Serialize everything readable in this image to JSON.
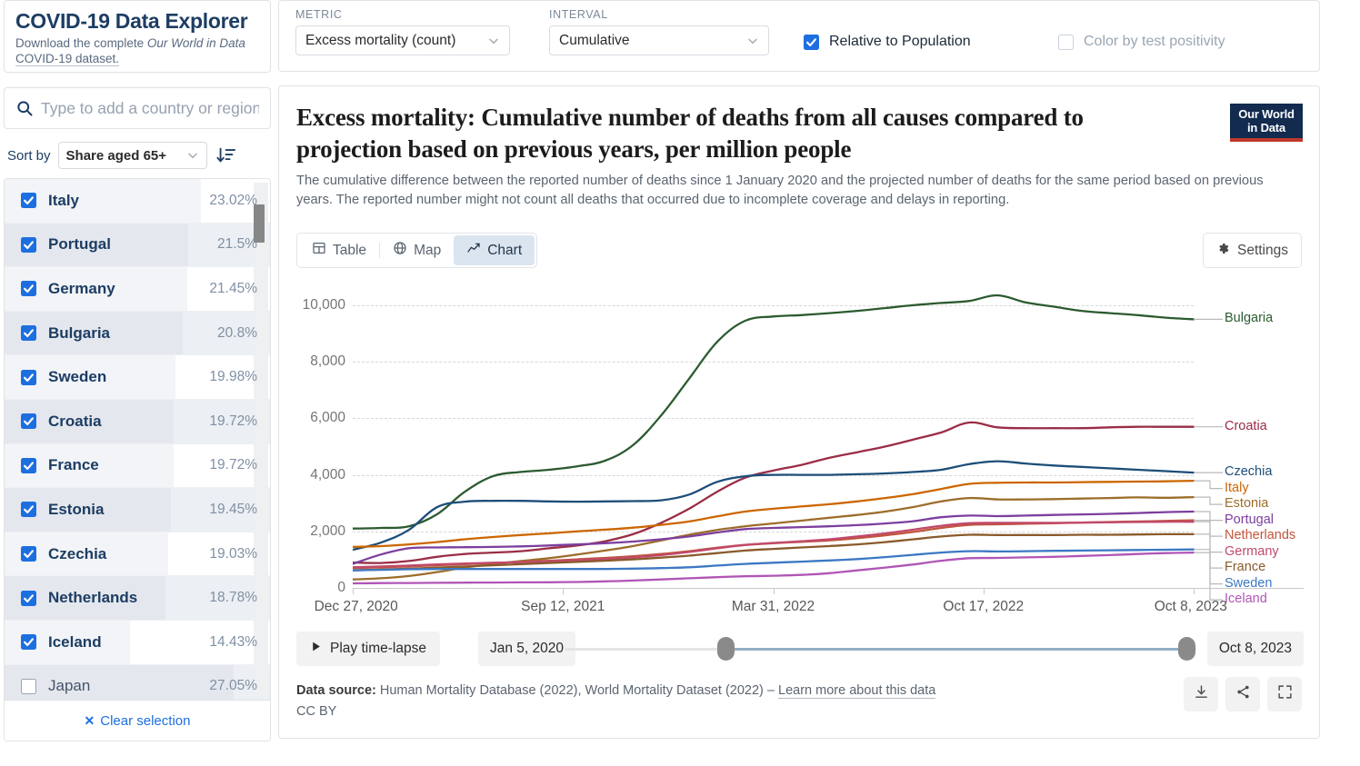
{
  "brand": {
    "title": "COVID-19 Data Explorer",
    "subtitle_pre": "Download the complete ",
    "subtitle_em": "Our World in Data",
    "subtitle_link": "COVID-19 dataset."
  },
  "search": {
    "placeholder": "Type to add a country or region...",
    "value": ""
  },
  "sort": {
    "label": "Sort by",
    "selected": "Share aged 65+",
    "direction_icon": "sort-descending-icon"
  },
  "country_list": {
    "max_value": 27.05,
    "rows": [
      {
        "name": "Italy",
        "value": "23.02%",
        "num": 23.02,
        "checked": true
      },
      {
        "name": "Portugal",
        "value": "21.5%",
        "num": 21.5,
        "checked": true
      },
      {
        "name": "Germany",
        "value": "21.45%",
        "num": 21.45,
        "checked": true
      },
      {
        "name": "Bulgaria",
        "value": "20.8%",
        "num": 20.8,
        "checked": true
      },
      {
        "name": "Sweden",
        "value": "19.98%",
        "num": 19.98,
        "checked": true
      },
      {
        "name": "Croatia",
        "value": "19.72%",
        "num": 19.72,
        "checked": true
      },
      {
        "name": "France",
        "value": "19.72%",
        "num": 19.72,
        "checked": true
      },
      {
        "name": "Estonia",
        "value": "19.45%",
        "num": 19.45,
        "checked": true
      },
      {
        "name": "Czechia",
        "value": "19.03%",
        "num": 19.03,
        "checked": true
      },
      {
        "name": "Netherlands",
        "value": "18.78%",
        "num": 18.78,
        "checked": true
      },
      {
        "name": "Iceland",
        "value": "14.43%",
        "num": 14.43,
        "checked": true
      },
      {
        "name": "Japan",
        "value": "27.05%",
        "num": 27.05,
        "checked": false
      }
    ],
    "clear_label": "Clear selection"
  },
  "controls": {
    "metric_label": "METRIC",
    "metric_value": "Excess mortality (count)",
    "interval_label": "INTERVAL",
    "interval_value": "Cumulative",
    "relative_label": "Relative to Population",
    "relative_checked": true,
    "positivity_label": "Color by test positivity",
    "positivity_checked": false
  },
  "chart": {
    "title": "Excess mortality: Cumulative number of deaths from all causes compared to projection based on previous years, per million people",
    "subtitle": "The cumulative difference between the reported number of deaths since 1 January 2020 and the projected number of deaths for the same period based on previous years. The reported number might not count all deaths that occurred due to incomplete coverage and delays in reporting.",
    "logo_line1": "Our World",
    "logo_line2": "in Data",
    "tabs": [
      {
        "label": "Table",
        "icon": "table-icon",
        "active": false
      },
      {
        "label": "Map",
        "icon": "globe-icon",
        "active": false
      },
      {
        "label": "Chart",
        "icon": "line-chart-icon",
        "active": true
      }
    ],
    "settings_label": "Settings"
  },
  "timeline": {
    "play_label": "Play time-lapse",
    "start_date": "Jan 5, 2020",
    "end_date": "Oct 8, 2023",
    "handle_left_pct": 25.5,
    "handle_right_pct": 98.5
  },
  "footer": {
    "source_prefix": "Data source:",
    "source_text": "Human Mortality Database (2022), World Mortality Dataset (2022) – ",
    "source_link": "Learn more about this data",
    "license": "CC BY",
    "buttons": [
      "download-icon",
      "share-icon",
      "expand-icon"
    ]
  },
  "chart_data": {
    "type": "line",
    "title": "Excess mortality: Cumulative number of deaths from all causes compared to projection based on previous years, per million people",
    "xlabel": "",
    "ylabel": "",
    "ylim": [
      0,
      10800
    ],
    "yticks": [
      0,
      2000,
      4000,
      6000,
      8000,
      10000
    ],
    "ytick_labels": [
      "0",
      "2,000",
      "4,000",
      "6,000",
      "8,000",
      "10,000"
    ],
    "xticks": [
      0,
      0.25,
      0.5,
      0.75,
      1.0
    ],
    "xtick_labels": [
      "Dec 27, 2020",
      "Sep 12, 2021",
      "Mar 31, 2022",
      "Oct 17, 2022",
      "Oct 8, 2023"
    ],
    "grid": true,
    "legend_position": "right-inline",
    "x_domain": [
      "Dec 27, 2020",
      "Oct 8, 2023"
    ],
    "series": [
      {
        "name": "Bulgaria",
        "color": "#2c5b30",
        "values": [
          2100,
          2120,
          2180,
          2600,
          3400,
          3950,
          4100,
          4180,
          4300,
          4500,
          5050,
          6100,
          7400,
          8700,
          9450,
          9600,
          9650,
          9720,
          9800,
          9900,
          10000,
          10080,
          10150,
          10350,
          10100,
          9950,
          9800,
          9720,
          9650,
          9560,
          9500
        ]
      },
      {
        "name": "Croatia",
        "color": "#9a2d45",
        "values": [
          900,
          880,
          950,
          1100,
          1200,
          1250,
          1300,
          1400,
          1500,
          1650,
          1900,
          2300,
          2800,
          3400,
          3900,
          4150,
          4350,
          4600,
          4800,
          5000,
          5250,
          5500,
          5850,
          5680,
          5650,
          5650,
          5650,
          5680,
          5700,
          5700,
          5700
        ]
      },
      {
        "name": "Czechia",
        "color": "#1d4e79",
        "values": [
          1350,
          1600,
          2050,
          2850,
          3050,
          3080,
          3080,
          3060,
          3050,
          3060,
          3070,
          3100,
          3300,
          3750,
          3950,
          4000,
          4000,
          4000,
          4020,
          4050,
          4100,
          4180,
          4380,
          4480,
          4400,
          4330,
          4280,
          4230,
          4180,
          4130,
          4080
        ]
      },
      {
        "name": "Italy",
        "color": "#cc6600",
        "values": [
          1450,
          1480,
          1540,
          1620,
          1720,
          1800,
          1870,
          1930,
          2000,
          2060,
          2130,
          2230,
          2350,
          2530,
          2700,
          2800,
          2880,
          2960,
          3060,
          3180,
          3320,
          3500,
          3680,
          3720,
          3730,
          3730,
          3740,
          3750,
          3760,
          3770,
          3790
        ]
      },
      {
        "name": "Estonia",
        "color": "#9c6d2a",
        "values": [
          300,
          340,
          420,
          560,
          720,
          840,
          950,
          1050,
          1180,
          1320,
          1480,
          1680,
          1880,
          2050,
          2180,
          2280,
          2380,
          2480,
          2580,
          2700,
          2860,
          3060,
          3180,
          3130,
          3130,
          3140,
          3160,
          3180,
          3200,
          3190,
          3210
        ]
      },
      {
        "name": "Portugal",
        "color": "#7c3f9e",
        "values": [
          850,
          1180,
          1400,
          1430,
          1440,
          1450,
          1470,
          1500,
          1540,
          1580,
          1640,
          1720,
          1820,
          1960,
          2080,
          2120,
          2150,
          2180,
          2220,
          2280,
          2360,
          2500,
          2560,
          2540,
          2560,
          2580,
          2600,
          2620,
          2650,
          2680,
          2700
        ]
      },
      {
        "name": "Netherlands",
        "color": "#c1553c",
        "values": [
          700,
          730,
          760,
          800,
          840,
          880,
          920,
          960,
          1010,
          1060,
          1120,
          1200,
          1300,
          1420,
          1520,
          1580,
          1630,
          1680,
          1760,
          1860,
          1980,
          2120,
          2230,
          2250,
          2270,
          2290,
          2310,
          2330,
          2350,
          2370,
          2390
        ]
      },
      {
        "name": "Germany",
        "color": "#c1496b",
        "values": [
          730,
          760,
          790,
          830,
          860,
          890,
          910,
          940,
          980,
          1020,
          1080,
          1160,
          1270,
          1400,
          1520,
          1590,
          1650,
          1720,
          1820,
          1930,
          2060,
          2200,
          2290,
          2300,
          2300,
          2300,
          2310,
          2320,
          2330,
          2340,
          2340
        ]
      },
      {
        "name": "France",
        "color": "#8a5a2b",
        "values": [
          620,
          650,
          680,
          720,
          760,
          800,
          840,
          880,
          920,
          960,
          1010,
          1070,
          1140,
          1230,
          1320,
          1380,
          1430,
          1480,
          1540,
          1620,
          1720,
          1820,
          1880,
          1870,
          1870,
          1870,
          1880,
          1880,
          1890,
          1900,
          1900
        ]
      },
      {
        "name": "Sweden",
        "color": "#3c78c3",
        "values": [
          620,
          640,
          660,
          670,
          670,
          670,
          670,
          670,
          670,
          670,
          680,
          700,
          730,
          790,
          850,
          890,
          930,
          970,
          1020,
          1090,
          1170,
          1250,
          1300,
          1290,
          1300,
          1310,
          1320,
          1330,
          1340,
          1350,
          1360
        ]
      },
      {
        "name": "Iceland",
        "color": "#b055b6",
        "values": [
          160,
          170,
          175,
          180,
          185,
          190,
          195,
          200,
          210,
          230,
          260,
          300,
          340,
          380,
          410,
          430,
          460,
          520,
          620,
          720,
          830,
          960,
          1050,
          1060,
          1080,
          1100,
          1130,
          1160,
          1200,
          1230,
          1250
        ]
      }
    ]
  }
}
